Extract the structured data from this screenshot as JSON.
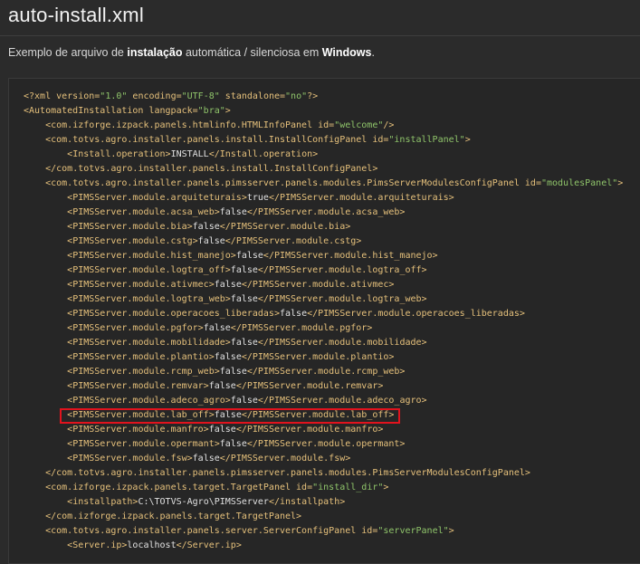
{
  "header": {
    "title": "auto-install.xml",
    "subtitle_prefix": "Exemplo de arquivo de ",
    "subtitle_bold1": "instalação",
    "subtitle_mid": " automática / silenciosa em ",
    "subtitle_bold2": "Windows",
    "subtitle_suffix": "."
  },
  "code_lines": [
    {
      "indent": 0,
      "parts": [
        [
          "decl",
          "<?xml version="
        ],
        [
          "str",
          "\"1.0\""
        ],
        [
          "decl",
          " encoding="
        ],
        [
          "str",
          "\"UTF-8\""
        ],
        [
          "decl",
          " standalone="
        ],
        [
          "str",
          "\"no\""
        ],
        [
          "decl",
          "?>"
        ]
      ]
    },
    {
      "indent": 0,
      "parts": [
        [
          "tag",
          "<AutomatedInstallation langpack="
        ],
        [
          "str",
          "\"bra\""
        ],
        [
          "tag",
          ">"
        ]
      ]
    },
    {
      "indent": 1,
      "parts": [
        [
          "tag",
          "<com.izforge.izpack.panels.htmlinfo.HTMLInfoPanel id="
        ],
        [
          "str",
          "\"welcome\""
        ],
        [
          "tag",
          "/>"
        ]
      ]
    },
    {
      "indent": 1,
      "parts": [
        [
          "tag",
          "<com.totvs.agro.installer.panels.install.InstallConfigPanel id="
        ],
        [
          "str",
          "\"installPanel\""
        ],
        [
          "tag",
          ">"
        ]
      ]
    },
    {
      "indent": 2,
      "parts": [
        [
          "tag",
          "<Install.operation>"
        ],
        [
          "text",
          "INSTALL"
        ],
        [
          "tag",
          "</Install.operation>"
        ]
      ]
    },
    {
      "indent": 1,
      "parts": [
        [
          "tag",
          "</com.totvs.agro.installer.panels.install.InstallConfigPanel>"
        ]
      ]
    },
    {
      "indent": 1,
      "parts": [
        [
          "tag",
          "<com.totvs.agro.installer.panels.pimsserver.panels.modules.PimsServerModulesConfigPanel id="
        ],
        [
          "str",
          "\"modulesPanel\""
        ],
        [
          "tag",
          ">"
        ]
      ]
    },
    {
      "indent": 2,
      "parts": [
        [
          "tag",
          "<PIMSServer.module.arquiteturais>"
        ],
        [
          "text",
          "true"
        ],
        [
          "tag",
          "</PIMSServer.module.arquiteturais>"
        ]
      ]
    },
    {
      "indent": 2,
      "parts": [
        [
          "tag",
          "<PIMSServer.module.acsa_web>"
        ],
        [
          "text",
          "false"
        ],
        [
          "tag",
          "</PIMSServer.module.acsa_web>"
        ]
      ]
    },
    {
      "indent": 2,
      "parts": [
        [
          "tag",
          "<PIMSServer.module.bia>"
        ],
        [
          "text",
          "false"
        ],
        [
          "tag",
          "</PIMSServer.module.bia>"
        ]
      ]
    },
    {
      "indent": 2,
      "parts": [
        [
          "tag",
          "<PIMSServer.module.cstg>"
        ],
        [
          "text",
          "false"
        ],
        [
          "tag",
          "</PIMSServer.module.cstg>"
        ]
      ]
    },
    {
      "indent": 2,
      "parts": [
        [
          "tag",
          "<PIMSServer.module.hist_manejo>"
        ],
        [
          "text",
          "false"
        ],
        [
          "tag",
          "</PIMSServer.module.hist_manejo>"
        ]
      ]
    },
    {
      "indent": 2,
      "parts": [
        [
          "tag",
          "<PIMSServer.module.logtra_off>"
        ],
        [
          "text",
          "false"
        ],
        [
          "tag",
          "</PIMSServer.module.logtra_off>"
        ]
      ]
    },
    {
      "indent": 2,
      "parts": [
        [
          "tag",
          "<PIMSServer.module.ativmec>"
        ],
        [
          "text",
          "false"
        ],
        [
          "tag",
          "</PIMSServer.module.ativmec>"
        ]
      ]
    },
    {
      "indent": 2,
      "parts": [
        [
          "tag",
          "<PIMSServer.module.logtra_web>"
        ],
        [
          "text",
          "false"
        ],
        [
          "tag",
          "</PIMSServer.module.logtra_web>"
        ]
      ]
    },
    {
      "indent": 2,
      "parts": [
        [
          "tag",
          "<PIMSServer.module.operacoes_liberadas>"
        ],
        [
          "text",
          "false"
        ],
        [
          "tag",
          "</PIMSServer.module.operacoes_liberadas>"
        ]
      ]
    },
    {
      "indent": 2,
      "parts": [
        [
          "tag",
          "<PIMSServer.module.pgfor>"
        ],
        [
          "text",
          "false"
        ],
        [
          "tag",
          "</PIMSServer.module.pgfor>"
        ]
      ]
    },
    {
      "indent": 2,
      "parts": [
        [
          "tag",
          "<PIMSServer.module.mobilidade>"
        ],
        [
          "text",
          "false"
        ],
        [
          "tag",
          "</PIMSServer.module.mobilidade>"
        ]
      ]
    },
    {
      "indent": 2,
      "parts": [
        [
          "tag",
          "<PIMSServer.module.plantio>"
        ],
        [
          "text",
          "false"
        ],
        [
          "tag",
          "</PIMSServer.module.plantio>"
        ]
      ]
    },
    {
      "indent": 2,
      "parts": [
        [
          "tag",
          "<PIMSServer.module.rcmp_web>"
        ],
        [
          "text",
          "false"
        ],
        [
          "tag",
          "</PIMSServer.module.rcmp_web>"
        ]
      ]
    },
    {
      "indent": 2,
      "parts": [
        [
          "tag",
          "<PIMSServer.module.remvar>"
        ],
        [
          "text",
          "false"
        ],
        [
          "tag",
          "</PIMSServer.module.remvar>"
        ]
      ]
    },
    {
      "indent": 2,
      "parts": [
        [
          "tag",
          "<PIMSServer.module.adeco_agro>"
        ],
        [
          "text",
          "false"
        ],
        [
          "tag",
          "</PIMSServer.module.adeco_agro>"
        ]
      ]
    },
    {
      "indent": 2,
      "highlight": true,
      "parts": [
        [
          "tag",
          "<PIMSServer.module.lab_off>"
        ],
        [
          "text",
          "false"
        ],
        [
          "tag",
          "</PIMSServer.module.lab_off>"
        ]
      ]
    },
    {
      "indent": 2,
      "parts": [
        [
          "tag",
          "<PIMSServer.module.manfro>"
        ],
        [
          "text",
          "false"
        ],
        [
          "tag",
          "</PIMSServer.module.manfro>"
        ]
      ]
    },
    {
      "indent": 2,
      "parts": [
        [
          "tag",
          "<PIMSServer.module.opermant>"
        ],
        [
          "text",
          "false"
        ],
        [
          "tag",
          "</PIMSServer.module.opermant>"
        ]
      ]
    },
    {
      "indent": 2,
      "parts": [
        [
          "tag",
          "<PIMSServer.module.fsw>"
        ],
        [
          "text",
          "false"
        ],
        [
          "tag",
          "</PIMSServer.module.fsw>"
        ]
      ]
    },
    {
      "indent": 1,
      "parts": [
        [
          "tag",
          "</com.totvs.agro.installer.panels.pimsserver.panels.modules.PimsServerModulesConfigPanel>"
        ]
      ]
    },
    {
      "indent": 1,
      "parts": [
        [
          "tag",
          "<com.izforge.izpack.panels.target.TargetPanel id="
        ],
        [
          "str",
          "\"install_dir\""
        ],
        [
          "tag",
          ">"
        ]
      ]
    },
    {
      "indent": 2,
      "parts": [
        [
          "tag",
          "<installpath>"
        ],
        [
          "text",
          "C:\\TOTVS-Agro\\PIMSServer"
        ],
        [
          "tag",
          "</installpath>"
        ]
      ]
    },
    {
      "indent": 1,
      "parts": [
        [
          "tag",
          "</com.izforge.izpack.panels.target.TargetPanel>"
        ]
      ]
    },
    {
      "indent": 1,
      "parts": [
        [
          "tag",
          "<com.totvs.agro.installer.panels.server.ServerConfigPanel id="
        ],
        [
          "str",
          "\"serverPanel\""
        ],
        [
          "tag",
          ">"
        ]
      ]
    },
    {
      "indent": 2,
      "parts": [
        [
          "tag",
          "<Server.ip>"
        ],
        [
          "text",
          "localhost"
        ],
        [
          "tag",
          "</Server.ip>"
        ]
      ]
    }
  ]
}
